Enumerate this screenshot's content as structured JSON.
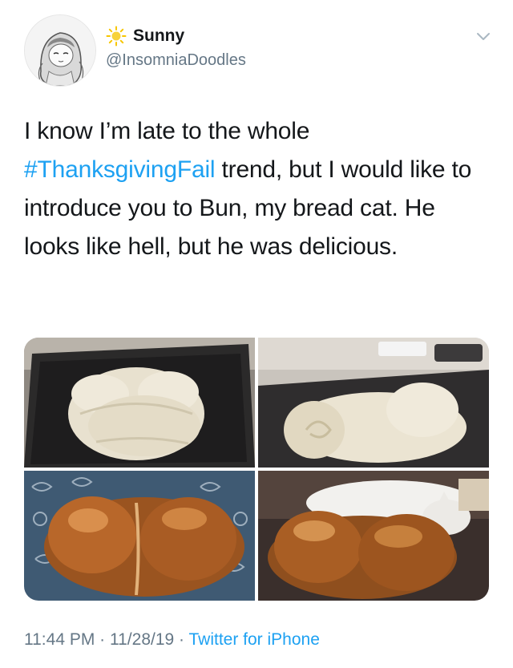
{
  "header": {
    "display_name": "Sunny",
    "handle": "@InsomniaDoodles",
    "name_emoji": "sun-icon",
    "menu_icon": "chevron-down-icon"
  },
  "tweet": {
    "text_before": "I know I’m late to the whole ",
    "hashtag": "#ThanksgivingFail",
    "text_after": " trend, but I would like to introduce you to Bun, my bread cat. He looks like hell, but he was delicious."
  },
  "photos": [
    {
      "name": "photo-raw-dough-top"
    },
    {
      "name": "photo-raw-dough-side"
    },
    {
      "name": "photo-baked-bread-top"
    },
    {
      "name": "photo-baked-bread-with-cat"
    }
  ],
  "footer": {
    "time": "11:44 PM",
    "sep1": " · ",
    "date": "11/28/19",
    "sep2": " · ",
    "source": "Twitter for iPhone"
  },
  "colors": {
    "link": "#1da1f2",
    "muted": "#657786",
    "text": "#14171a"
  }
}
